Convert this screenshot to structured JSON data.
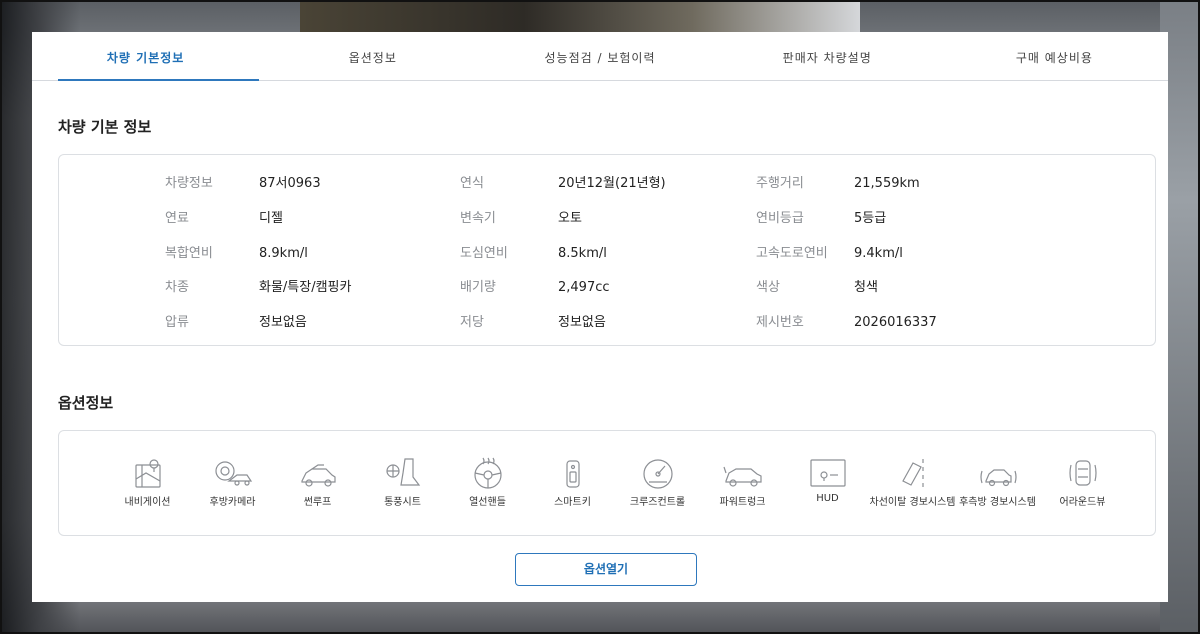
{
  "tabs": [
    {
      "label": "차량 기본정보",
      "active": true
    },
    {
      "label": "옵션정보",
      "active": false
    },
    {
      "label": "성능점검 / 보험이력",
      "active": false
    },
    {
      "label": "판매자 차량설명",
      "active": false
    },
    {
      "label": "구매 예상비용",
      "active": false
    }
  ],
  "basic_info": {
    "title": "차량 기본 정보",
    "rows": [
      [
        {
          "label": "차량정보",
          "value": "87서0963"
        },
        {
          "label": "연식",
          "value": "20년12월(21년형)"
        },
        {
          "label": "주행거리",
          "value": "21,559km"
        }
      ],
      [
        {
          "label": "연료",
          "value": "디젤"
        },
        {
          "label": "변속기",
          "value": "오토"
        },
        {
          "label": "연비등급",
          "value": "5등급"
        }
      ],
      [
        {
          "label": "복합연비",
          "value": "8.9km/l"
        },
        {
          "label": "도심연비",
          "value": "8.5km/l"
        },
        {
          "label": "고속도로연비",
          "value": "9.4km/l"
        }
      ],
      [
        {
          "label": "차종",
          "value": "화물/특장/캠핑카"
        },
        {
          "label": "배기량",
          "value": "2,497cc"
        },
        {
          "label": "색상",
          "value": "청색"
        }
      ],
      [
        {
          "label": "압류",
          "value": "정보없음"
        },
        {
          "label": "저당",
          "value": "정보없음"
        },
        {
          "label": "제시번호",
          "value": "2026016337"
        }
      ]
    ]
  },
  "options": {
    "title": "옵션정보",
    "items": [
      {
        "label": "내비게이션",
        "icon": "navigation-icon"
      },
      {
        "label": "후방카메라",
        "icon": "rear-camera-icon"
      },
      {
        "label": "썬루프",
        "icon": "sunroof-icon"
      },
      {
        "label": "통풍시트",
        "icon": "ventilated-seat-icon"
      },
      {
        "label": "열선핸들",
        "icon": "heated-steering-icon"
      },
      {
        "label": "스마트키",
        "icon": "smart-key-icon"
      },
      {
        "label": "크루즈컨트롤",
        "icon": "cruise-control-icon"
      },
      {
        "label": "파워트렁크",
        "icon": "power-trunk-icon"
      },
      {
        "label": "HUD",
        "icon": "hud-icon"
      },
      {
        "label": "차선이탈 경보시스템",
        "icon": "lane-departure-icon"
      },
      {
        "label": "후측방 경보시스템",
        "icon": "blind-spot-icon"
      },
      {
        "label": "어라운드뷰",
        "icon": "around-view-icon"
      }
    ],
    "open_button": "옵션열기"
  },
  "colors": {
    "accent": "#2e78bd",
    "label": "#8a8d92",
    "border": "#dcdfe3"
  }
}
